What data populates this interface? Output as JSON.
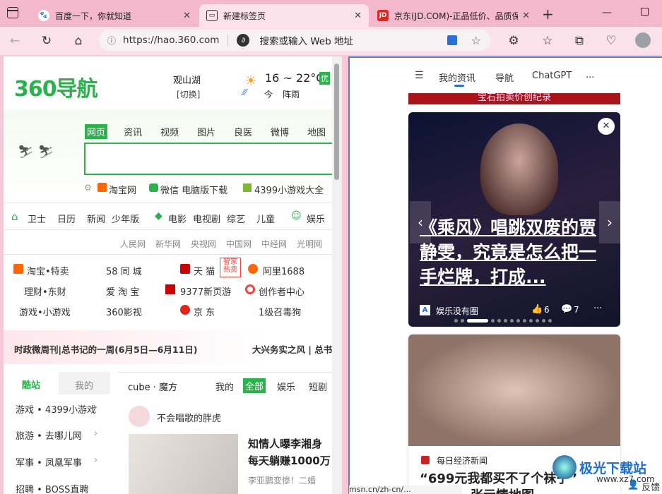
{
  "tabs": [
    {
      "title": "百度一下，你就知道",
      "icon": "baidu-icon"
    },
    {
      "title": "新建标签页",
      "icon": "newtab-icon"
    },
    {
      "title": "京东(JD.COM)-正品低价、品质保",
      "icon": "jd-icon"
    }
  ],
  "address": {
    "url": "https://hao.360.com",
    "search_placeholder": "搜索或输入 Web 地址"
  },
  "left": {
    "logo": "360导航",
    "city": "观山湖",
    "city_switch": "[切换]",
    "weather": {
      "temp": "16 ~ 22°C",
      "quality": "优",
      "today": "今",
      "desc": "阵雨"
    },
    "search_tabs": [
      "网页",
      "资讯",
      "视频",
      "图片",
      "良医",
      "微博",
      "地图"
    ],
    "search_links": [
      "淘宝网",
      "微信 电脑版下载",
      "4399小游戏大全"
    ],
    "nav_row": [
      "卫士",
      "日历",
      "新闻",
      "少年版",
      "电影",
      "电视剧",
      "综艺",
      "儿童",
      "娱乐"
    ],
    "sub_links": [
      "人民网",
      "新华网",
      "央视网",
      "中国网",
      "中经网",
      "光明网"
    ],
    "sites": [
      [
        "淘宝•特卖",
        "58 同 城",
        "天 猫",
        "阿里1688"
      ],
      [
        "理财•东财",
        "爱 淘 宝",
        "9377新页游",
        "创作者中心"
      ],
      [
        "游戏•小游戏",
        "360影视",
        "京 东",
        "1级召毒狗"
      ]
    ],
    "tmall_badge": "智家热卖",
    "banner_left": "时政微周刊|总书记的一周(6月5日—6月11日)",
    "banner_right": "大兴务实之风 | 总书",
    "side_tabs": [
      "酷站",
      "我的"
    ],
    "side_list": [
      "游戏 • 4399小游戏",
      "旅游 • 去哪儿网",
      "军事 • 凤凰军事",
      "招聘 • BOSS直聘"
    ],
    "feed_title": "cube · 魔方",
    "feed_tabs": [
      "我的",
      "全部",
      "娱乐",
      "短剧"
    ],
    "feed_author": "不会唱歌的胖虎",
    "feed_headline1": "知情人曝李湘身",
    "feed_headline2": "每天躺赚1000万",
    "feed_meta": "李亚鹏变惨！二婚"
  },
  "right": {
    "nav": [
      "我的资讯",
      "导航",
      "ChatGPT",
      "..."
    ],
    "top_strip": "宝石拍卖价创纪录",
    "card1": {
      "headline": "《乘风》唱跳双废的贾静雯，究竟是怎么把一手烂牌，打成...",
      "source": "娱乐没有圈",
      "likes": "6",
      "comments": "7"
    },
    "card2": {
      "source": "每日经济新闻",
      "headline": "“699元我都买不了个袜子”",
      "headline2": "货图有，张示情地图..."
    },
    "status_url": "msn.cn/zh-cn/...",
    "feedback": "反馈"
  },
  "watermark": {
    "title": "极光下载站",
    "url": "www.xz7.com"
  }
}
